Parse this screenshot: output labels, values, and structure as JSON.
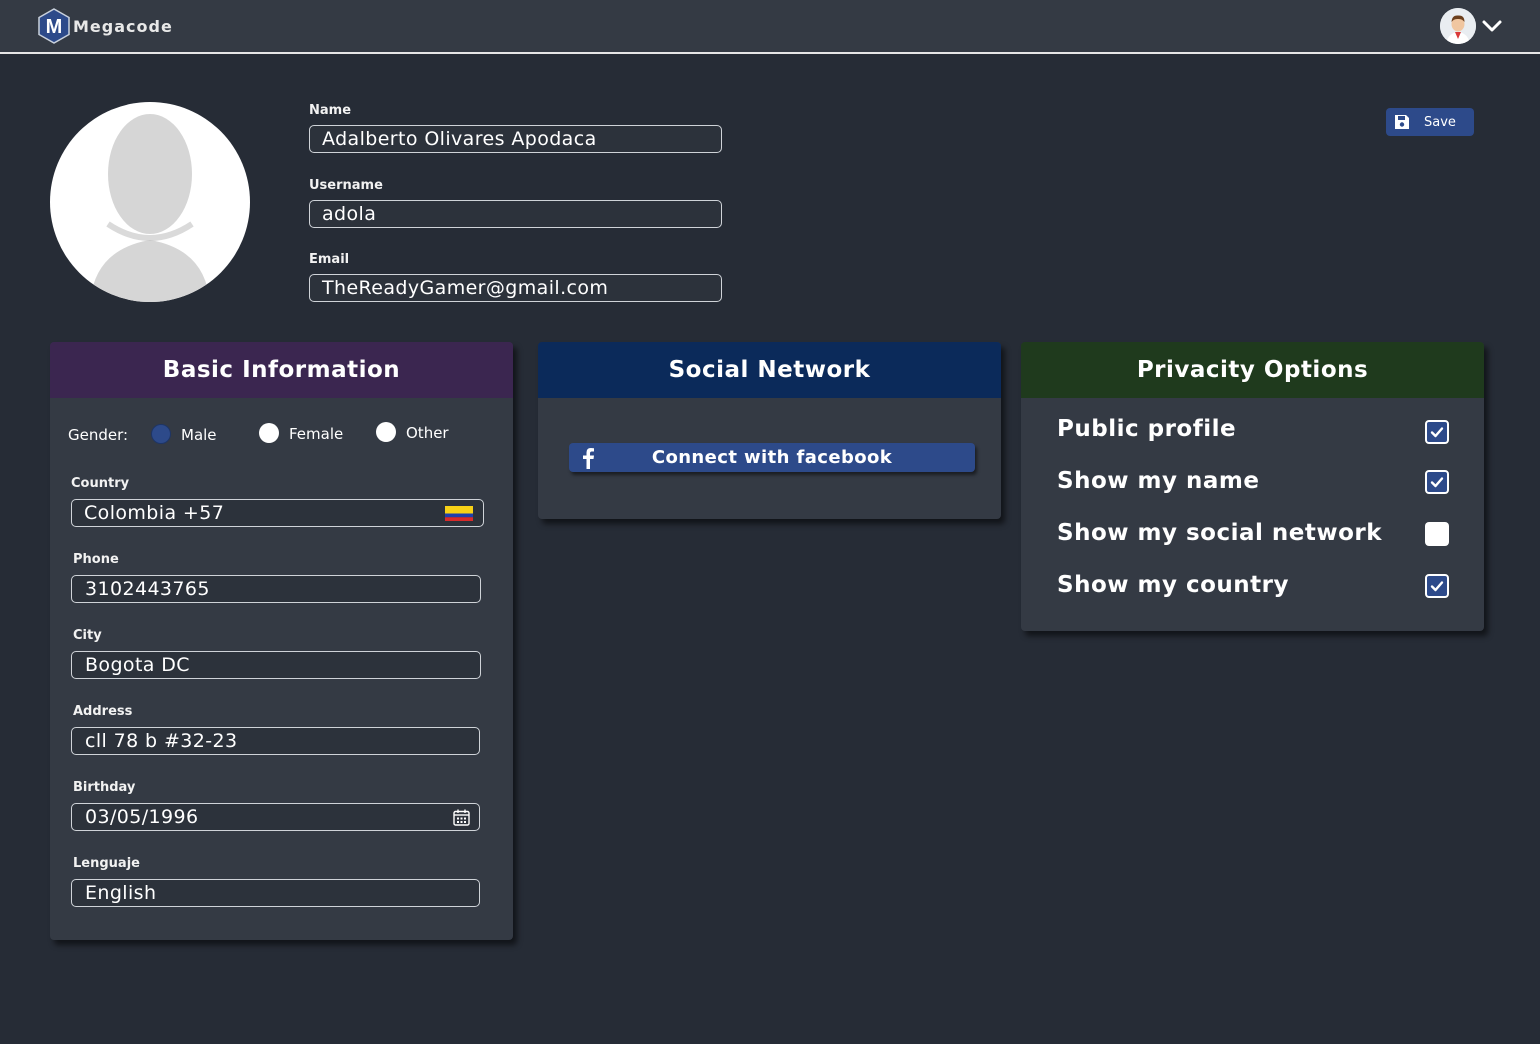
{
  "app": {
    "name": "Megacode",
    "logo_letter": "M"
  },
  "header": {
    "user_menu_icon": "chevron-down-icon",
    "avatar_icon": "user-avatar"
  },
  "profile": {
    "name_label": "Name",
    "name_value": "Adalberto Olivares Apodaca",
    "username_label": "Username",
    "username_value": "adola",
    "email_label": "Email",
    "email_value": "TheReadyGamer@gmail.com",
    "save_label": "Save",
    "save_icon": "floppy-disk-icon"
  },
  "basic_info": {
    "title": "Basic Information",
    "gender_label": "Gender:",
    "gender_options": [
      {
        "label": "Male",
        "selected": true
      },
      {
        "label": "Female",
        "selected": false
      },
      {
        "label": "Other",
        "selected": false
      }
    ],
    "country_label": "Country",
    "country_value": "Colombia +57",
    "country_flag": "colombia-flag",
    "phone_label": "Phone",
    "phone_value": "3102443765",
    "city_label": "City",
    "city_value": "Bogota DC",
    "address_label": "Address",
    "address_value": "cll 78 b #32-23",
    "birthday_label": "Birthday",
    "birthday_value": "03/05/1996",
    "birthday_icon": "calendar-icon",
    "language_label": "Lenguaje",
    "language_value": "English"
  },
  "social": {
    "title": "Social Network",
    "facebook_label": "Connect with facebook",
    "facebook_icon": "facebook-icon"
  },
  "privacy": {
    "title": "Privacity Options",
    "options": [
      {
        "label": "Public profile",
        "checked": true
      },
      {
        "label": "Show my name",
        "checked": true
      },
      {
        "label": "Show my social network",
        "checked": false
      },
      {
        "label": "Show my country",
        "checked": true
      }
    ]
  },
  "colors": {
    "background": "#262c36",
    "topbar": "#343a44",
    "card": "#343a44",
    "basic_header": "#3b2650",
    "social_header": "#0b2a5a",
    "privacy_header": "#1f3a1d",
    "accent": "#2d4a8a"
  }
}
